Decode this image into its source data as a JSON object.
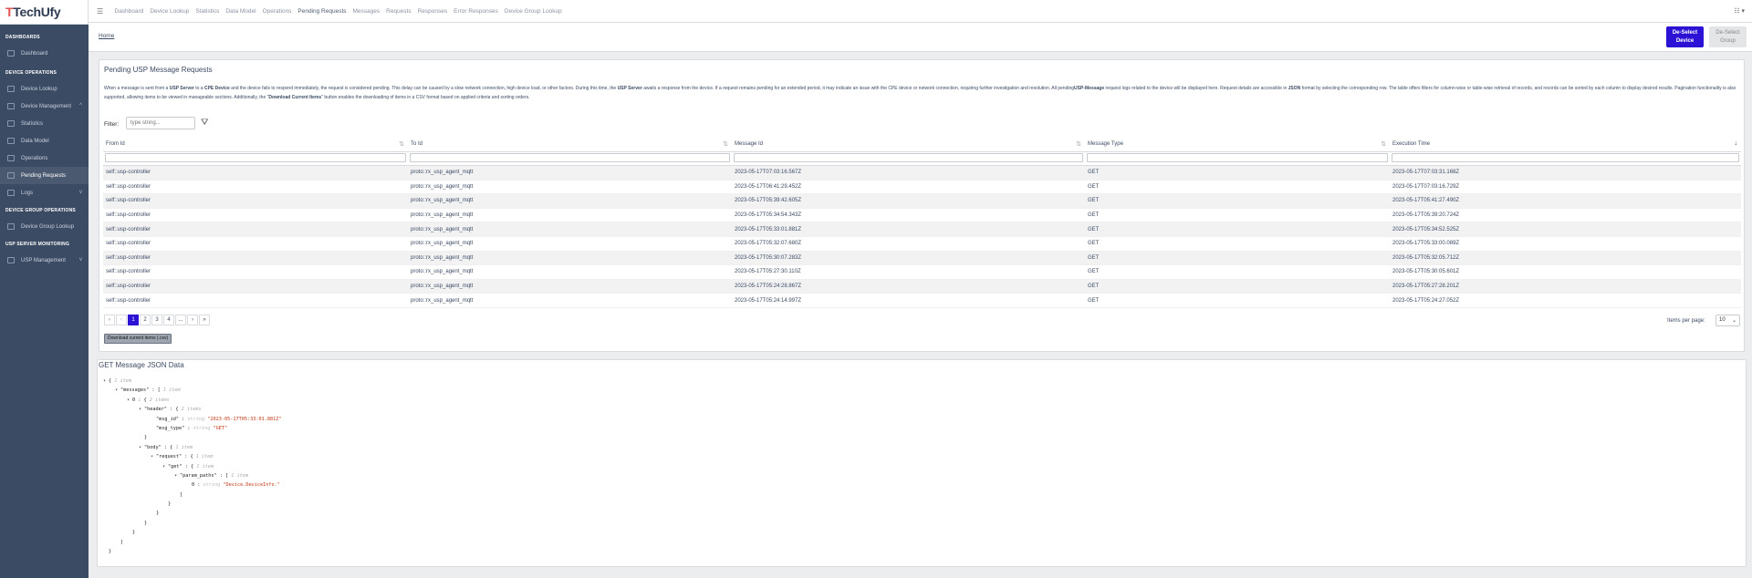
{
  "brand": {
    "name_prefix": "T",
    "name_rest": "TechUfy"
  },
  "sidebar": {
    "sections": [
      {
        "title": "DASHBOARDS",
        "items": [
          {
            "label": "Dashboard"
          }
        ]
      },
      {
        "title": "DEVICE OPERATIONS",
        "items": [
          {
            "label": "Device Lookup"
          },
          {
            "label": "Device Management"
          },
          {
            "label": "Statistics"
          },
          {
            "label": "Data Model"
          },
          {
            "label": "Operations"
          },
          {
            "label": "Pending Requests"
          },
          {
            "label": "Logs"
          }
        ]
      },
      {
        "title": "DEVICE GROUP OPERATIONS",
        "items": [
          {
            "label": "Device Group Lookup"
          }
        ]
      },
      {
        "title": "USP SERVER MONITORING",
        "items": [
          {
            "label": "USP Management"
          }
        ]
      }
    ]
  },
  "topnav": [
    "Dashboard",
    "Device Lookup",
    "Statistics",
    "Data Model",
    "Operations",
    "Pending Requests",
    "Messages",
    "Requests",
    "Responses",
    "Error Responses",
    "Device Group Lookup"
  ],
  "breadcrumb": "Home",
  "buttons": {
    "deselect_device_1": "De-Select",
    "deselect_device_2": "Device",
    "deselect_group_1": "De-Select",
    "deselect_group_2": "Group"
  },
  "card": {
    "title": "Pending USP Message Requests",
    "desc": {
      "p1": "When a message is sent from a ",
      "b1": "USP Server",
      "p2": " to a ",
      "b2": "CPE Device",
      "p3": " and the device fails to respond immediately, the request is considered pending. This delay can be caused by a slow network connection, high device load, or other factors. During this time, the ",
      "b3": "USP Server",
      "p4": " awaits a response from the device. If a request remains pending for an extended period, it may indicate an issue with the CPE device or network connection, requiring further investigation and resolution. All pending",
      "b4": "USP-Message",
      "p5": " request logs related to the device will be displayed here. Request details are accessible in ",
      "b5": "JSON",
      "p6": " format by selecting the corresponding row. The table offers filters for column-wise or table-wise retrieval of records, and records can be sorted by each column to display desired results. Pagination functionality is also supported, allowing items to be viewed in manageable sections. Additionally, the \"",
      "b6": "Download Current Items",
      "p7": "\" button enables the downloading of items in a CSV format based on applied criteria and sorting orders."
    },
    "filter_label": "Filter:",
    "filter_placeholder": "type string...",
    "columns": [
      "From Id",
      "To Id",
      "Message Id",
      "Message Type",
      "Execution Time"
    ],
    "rows": [
      [
        "self::usp-controller",
        "proto::rx_usp_agent_mqtt",
        "2023-05-17T07:03:16.567Z",
        "GET",
        "2023-05-17T07:03:31.168Z"
      ],
      [
        "self::usp-controller",
        "proto::rx_usp_agent_mqtt",
        "2023-05-17T06:41:29.452Z",
        "GET",
        "2023-05-17T07:03:16.729Z"
      ],
      [
        "self::usp-controller",
        "proto::rx_usp_agent_mqtt",
        "2023-05-17T05:39:42.605Z",
        "GET",
        "2023-05-17T05:41:27.490Z"
      ],
      [
        "self::usp-controller",
        "proto::rx_usp_agent_mqtt",
        "2023-05-17T05:34:54.343Z",
        "GET",
        "2023-05-17T05:39:20.724Z"
      ],
      [
        "self::usp-controller",
        "proto::rx_usp_agent_mqtt",
        "2023-05-17T05:33:01.881Z",
        "GET",
        "2023-05-17T05:34:52.525Z"
      ],
      [
        "self::usp-controller",
        "proto::rx_usp_agent_mqtt",
        "2023-05-17T05:32:07.680Z",
        "GET",
        "2023-05-17T05:33:00.089Z"
      ],
      [
        "self::usp-controller",
        "proto::rx_usp_agent_mqtt",
        "2023-05-17T05:30:07.283Z",
        "GET",
        "2023-05-17T05:32:05.712Z"
      ],
      [
        "self::usp-controller",
        "proto::rx_usp_agent_mqtt",
        "2023-05-17T05:27:30.110Z",
        "GET",
        "2023-05-17T05:30:05.601Z"
      ],
      [
        "self::usp-controller",
        "proto::rx_usp_agent_mqtt",
        "2023-05-17T05:24:28.867Z",
        "GET",
        "2023-05-17T05:27:28.201Z"
      ],
      [
        "self::usp-controller",
        "proto::rx_usp_agent_mqtt",
        "2023-05-17T05:24:14.997Z",
        "GET",
        "2023-05-17T05:24:27.052Z"
      ]
    ],
    "pagination": [
      "«",
      "‹",
      "1",
      "2",
      "3",
      "4",
      "...",
      "›",
      "»"
    ],
    "active_page": "1",
    "items_per_page_label": "Items per page:",
    "items_per_page": "10",
    "download_label": "Download current items (.csv)"
  },
  "json_card": {
    "title": "GET Message JSON Data",
    "lines": [
      {
        "indent": 0,
        "caret": "▾",
        "text": "{",
        "meta": "1 item"
      },
      {
        "indent": 1,
        "caret": "▾",
        "key": "\"messages\"",
        "text": " : [",
        "meta": "1 item"
      },
      {
        "indent": 2,
        "caret": "▾",
        "key": "0",
        "text": " : {",
        "meta": "2 items"
      },
      {
        "indent": 3,
        "caret": "▾",
        "key": "\"header\"",
        "text": " : {",
        "meta": "2 items"
      },
      {
        "indent": 4,
        "caret": "",
        "key": "\"msg_id\"",
        "text": " : ",
        "type": "string",
        "val": "\"2023-05-17T05:33:01.881Z\""
      },
      {
        "indent": 4,
        "caret": "",
        "key": "\"msg_type\"",
        "text": " : ",
        "type": "string",
        "val": "\"GET\""
      },
      {
        "indent": 3,
        "caret": "",
        "text": "}"
      },
      {
        "indent": 3,
        "caret": "▾",
        "key": "\"body\"",
        "text": " : {",
        "meta": "1 item"
      },
      {
        "indent": 4,
        "caret": "▾",
        "key": "\"request\"",
        "text": " : {",
        "meta": "1 item"
      },
      {
        "indent": 5,
        "caret": "▾",
        "key": "\"get\"",
        "text": " : {",
        "meta": "1 item"
      },
      {
        "indent": 6,
        "caret": "▾",
        "key": "\"param_paths\"",
        "text": " : [",
        "meta": "1 item"
      },
      {
        "indent": 7,
        "caret": "",
        "key": "0",
        "text": " : ",
        "type": "string",
        "val": "\"Device.DeviceInfo.\""
      },
      {
        "indent": 6,
        "caret": "",
        "text": "]"
      },
      {
        "indent": 5,
        "caret": "",
        "text": "}"
      },
      {
        "indent": 4,
        "caret": "",
        "text": "}"
      },
      {
        "indent": 3,
        "caret": "",
        "text": "}"
      },
      {
        "indent": 2,
        "caret": "",
        "text": "}"
      },
      {
        "indent": 1,
        "caret": "",
        "text": "]"
      },
      {
        "indent": 0,
        "caret": "",
        "text": "}"
      }
    ]
  }
}
